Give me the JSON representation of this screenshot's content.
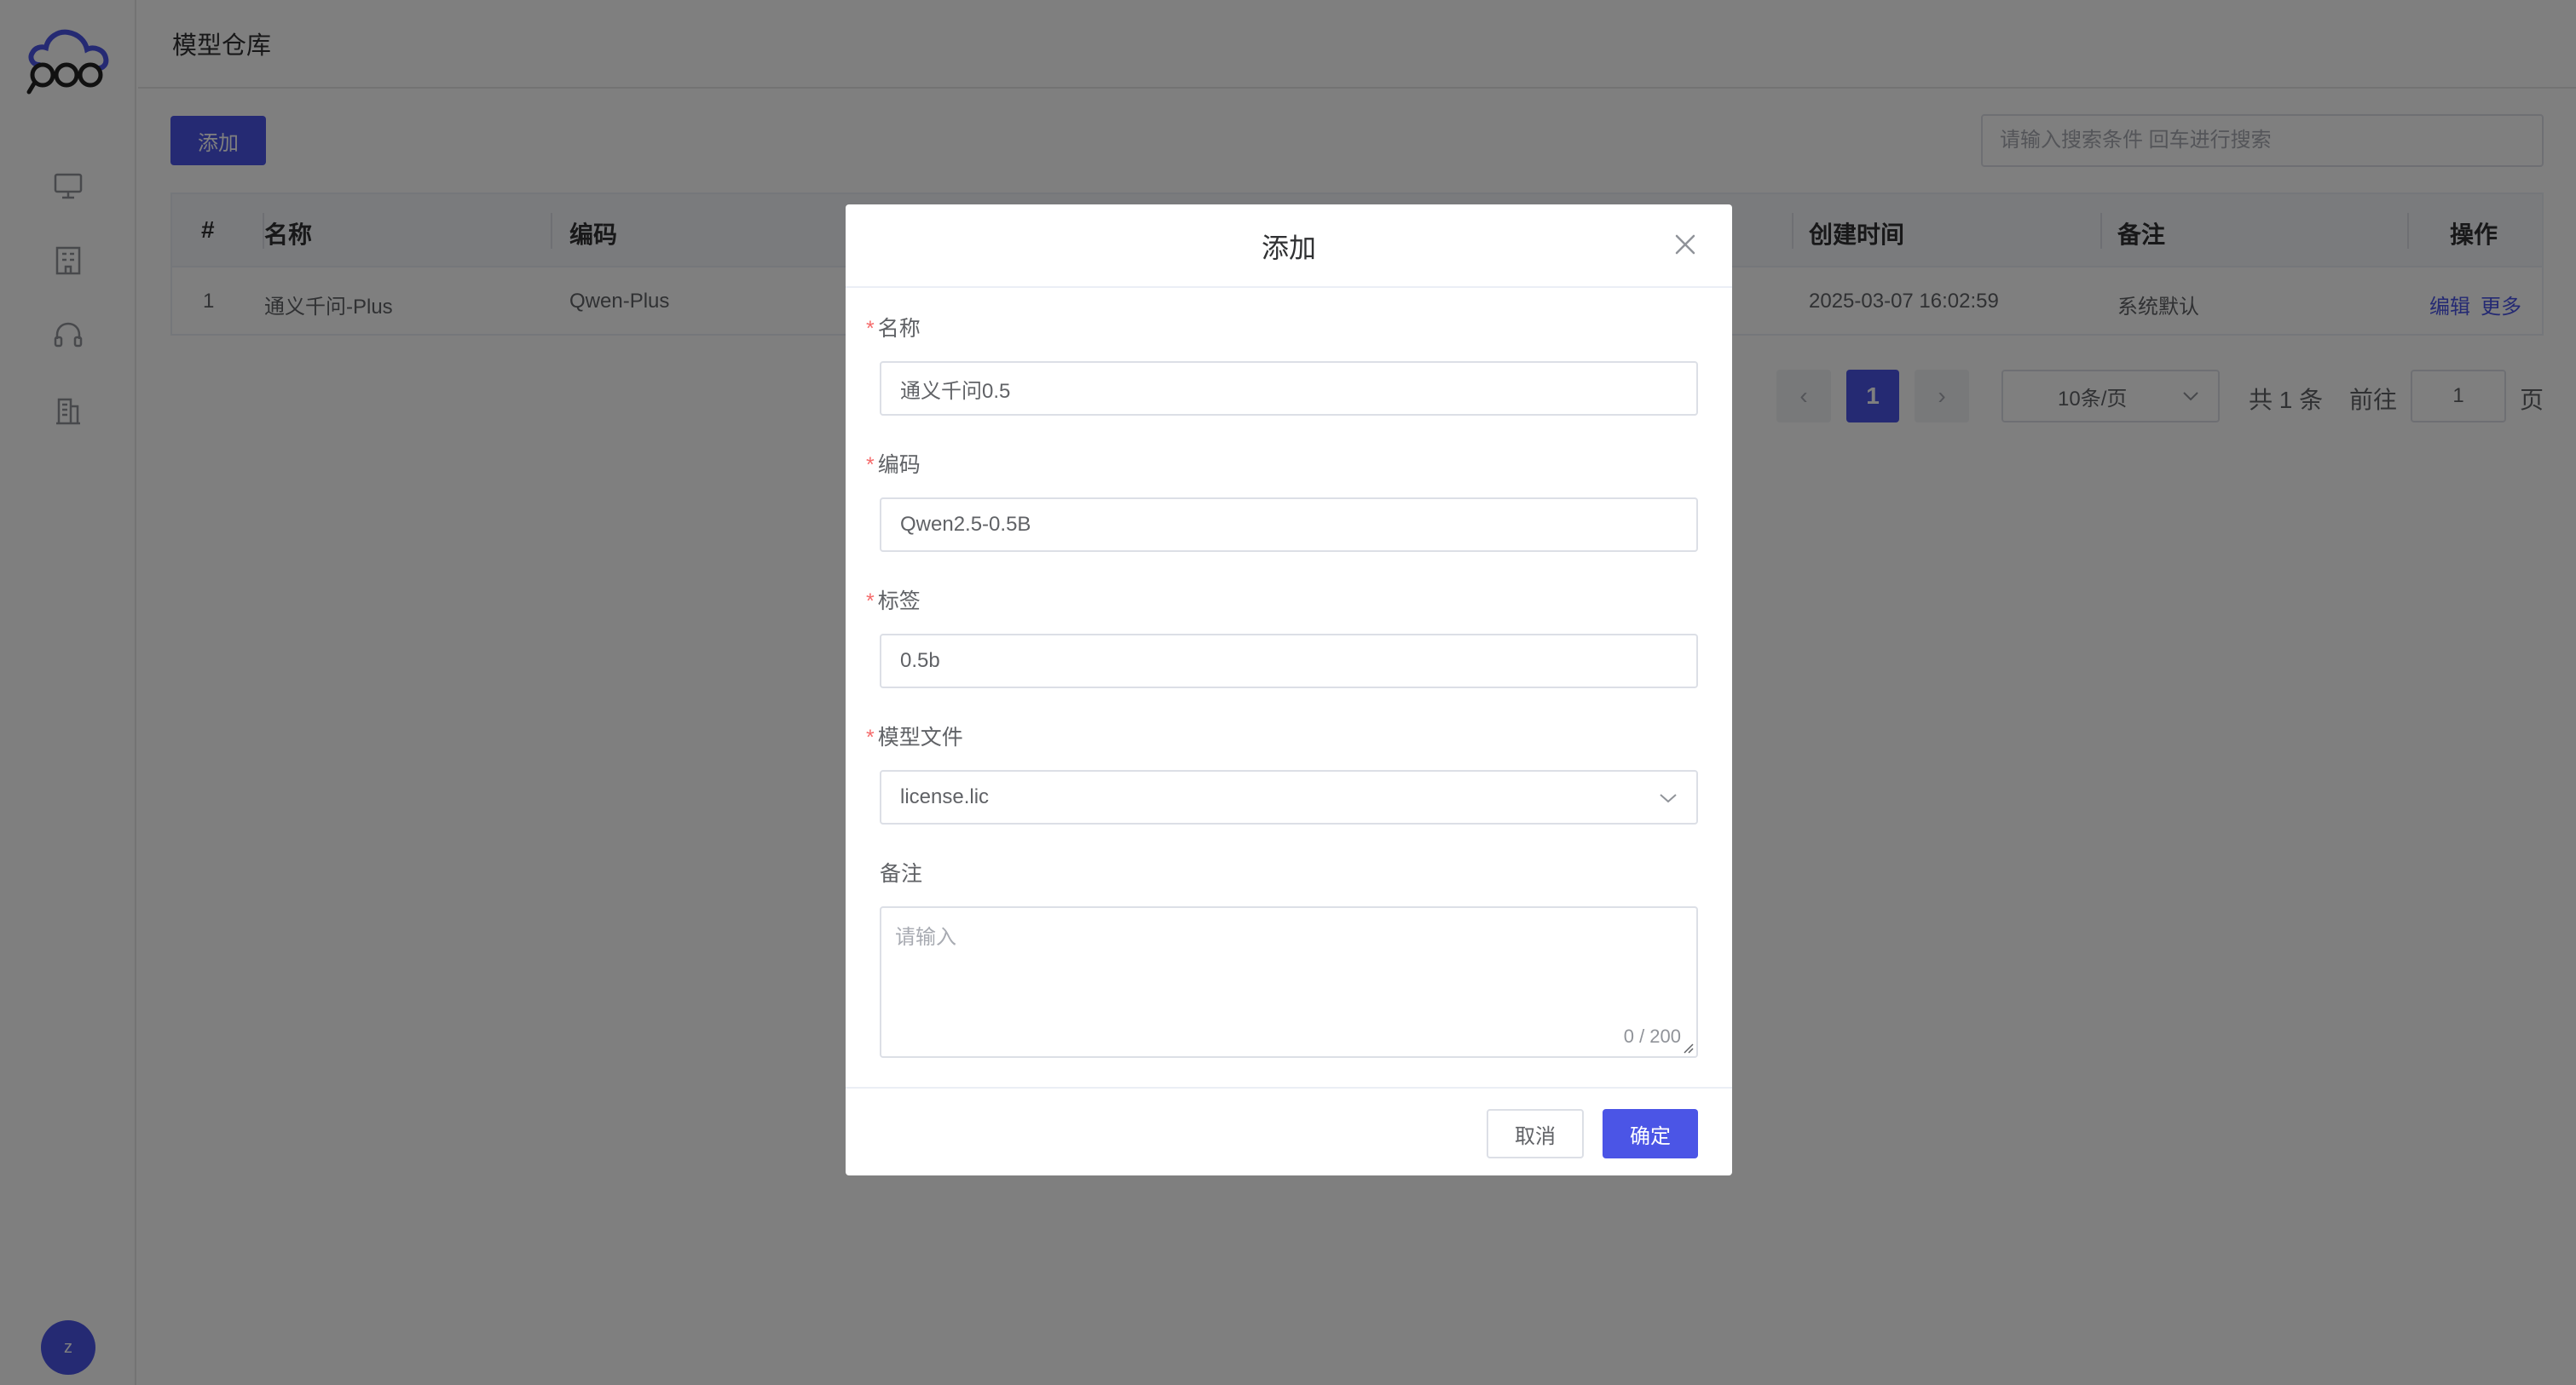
{
  "header": {
    "title": "模型仓库"
  },
  "toolbar": {
    "add_label": "添加",
    "search_placeholder": "请输入搜索条件 回车进行搜索"
  },
  "sidebar": {
    "icons": [
      "monitor-icon",
      "building-icon",
      "headset-icon",
      "office-icon"
    ],
    "avatar_letter": "z"
  },
  "table": {
    "columns": [
      "#",
      "名称",
      "编码",
      "创建时间",
      "备注",
      "操作"
    ],
    "rows": [
      {
        "index": "1",
        "name": "通义千问-Plus",
        "code": "Qwen-Plus",
        "created": "2025-03-07 16:02:59",
        "remark": "系统默认",
        "edit": "编辑",
        "more": "更多"
      }
    ]
  },
  "pagination": {
    "prev": "‹",
    "next": "›",
    "current_page": "1",
    "page_size": "10条/页",
    "total": "共 1 条",
    "goto_label": "前往",
    "goto_value": "1",
    "page_suffix": "页"
  },
  "dialog": {
    "title": "添加",
    "close_icon": "close-icon",
    "fields": {
      "name": {
        "label": "名称",
        "value": "通义千问0.5",
        "required": "*"
      },
      "code": {
        "label": "编码",
        "value": "Qwen2.5-0.5B",
        "required": "*"
      },
      "tag": {
        "label": "标签",
        "value": "0.5b",
        "required": "*"
      },
      "model_file": {
        "label": "模型文件",
        "value": "license.lic",
        "required": "*"
      },
      "remark": {
        "label": "备注",
        "placeholder": "请输入",
        "counter": "0 / 200"
      }
    },
    "cancel_label": "取消",
    "ok_label": "确定"
  },
  "colors": {
    "primary": "#4b55e6",
    "required": "#f56c6c",
    "overlay": "rgba(0,0,0,0.5)"
  }
}
